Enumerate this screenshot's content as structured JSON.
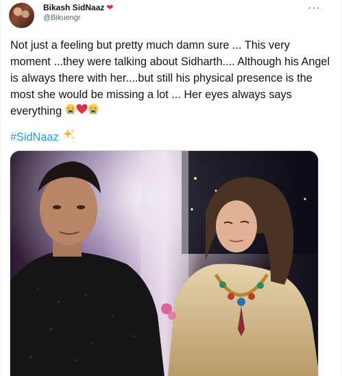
{
  "author": {
    "name": "Bikash SidNaaz",
    "badge_icon": "heart-icon",
    "handle": "@Bikuengr"
  },
  "more_icon": "ellipsis-icon",
  "tweet": {
    "text": "Not just a feeling but pretty much damn sure ... This very moment ...they were talking about Sidharth.... Although his Angel is always there with her....but still his physical presence is the most she would be missing a lot ... Her eyes always says everything",
    "trailing_emojis": [
      "crying-face",
      "red-heart",
      "crying-face"
    ],
    "hashtag": "#SidNaaz",
    "hashtag_emoji": "sparkles"
  },
  "media": {
    "kind": "photo",
    "colors": {
      "night": "#1a1220",
      "outfit_gold": "#d8c39a",
      "kurta_black": "#141414"
    }
  }
}
